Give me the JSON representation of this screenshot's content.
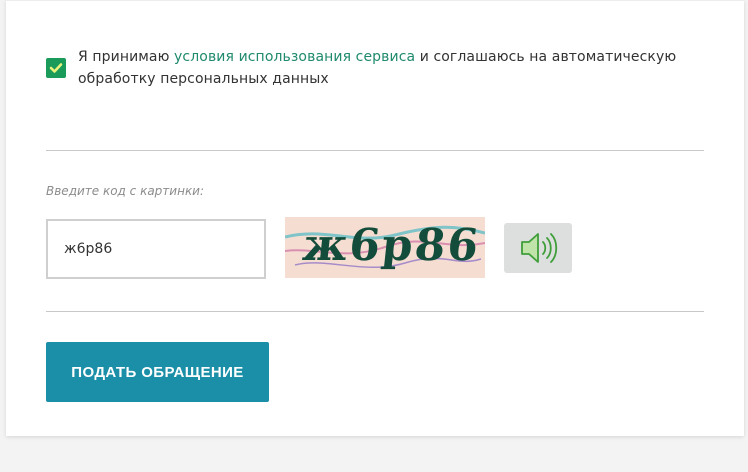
{
  "consent": {
    "checked": true,
    "text_before": "Я принимаю ",
    "link_text": "условия использования сервиса",
    "text_after": " и соглашаюсь на автоматическую обработку персональных данных"
  },
  "captcha": {
    "label": "Введите код с картинки:",
    "input_value": "ж6р86",
    "image_text": "ж6р86",
    "audio_icon": "speaker-icon"
  },
  "submit": {
    "label": "ПОДАТЬ ОБРАЩЕНИЕ"
  },
  "colors": {
    "checkbox": "#1a9b5a",
    "link": "#1f8a6d",
    "submit_bg": "#1b8fa8",
    "captcha_bg": "#f6ddd2"
  }
}
